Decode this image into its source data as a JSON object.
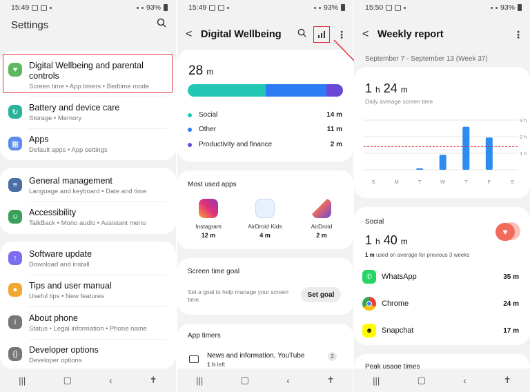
{
  "settings": {
    "time": "15:49",
    "battery": "93%",
    "title": "Settings",
    "items": [
      {
        "title": "Digital Wellbeing and parental controls",
        "sub": "Screen time  •  App timers  •  Bedtime mode",
        "color": "#5cb85c"
      },
      {
        "title": "Battery and device care",
        "sub": "Storage  •  Memory",
        "color": "#2bb39a"
      },
      {
        "title": "Apps",
        "sub": "Default apps  •  App settings",
        "color": "#5b8def"
      },
      {
        "title": "General management",
        "sub": "Language and keyboard  •  Date and time",
        "color": "#4a6fa5"
      },
      {
        "title": "Accessibility",
        "sub": "TalkBack  •  Mono audio  •  Assistant menu",
        "color": "#3aa05a"
      },
      {
        "title": "Software update",
        "sub": "Download and install",
        "color": "#7b6cf0"
      },
      {
        "title": "Tips and user manual",
        "sub": "Useful tips  •  New features",
        "color": "#f0a830"
      },
      {
        "title": "About phone",
        "sub": "Status  •  Legal information  •  Phone name",
        "color": "#777777"
      },
      {
        "title": "Developer options",
        "sub": "Developer options",
        "color": "#777777"
      }
    ]
  },
  "wellbeing": {
    "time": "15:49",
    "battery": "93%",
    "title": "Digital Wellbeing",
    "total_value": "28",
    "total_unit": "m",
    "bar": [
      {
        "fraction": 0.5,
        "color": "#22c7b5"
      },
      {
        "fraction": 0.393,
        "color": "#2d7cf6"
      },
      {
        "fraction": 0.107,
        "color": "#6a48d7"
      }
    ],
    "legend": [
      {
        "name": "Social",
        "value": "14 m",
        "color": "#22c7b5"
      },
      {
        "name": "Other",
        "value": "11 m",
        "color": "#2d7cf6"
      },
      {
        "name": "Productivity and finance",
        "value": "2 m",
        "color": "#6a48d7"
      }
    ],
    "most_used_title": "Most used apps",
    "apps": [
      {
        "name": "Instagram",
        "dur": "12 m"
      },
      {
        "name": "AirDroid Kids",
        "dur": "4 m"
      },
      {
        "name": "AirDroid",
        "dur": "2 m"
      }
    ],
    "goal_title": "Screen time goal",
    "goal_desc": "Set a goal to help manage your screen time.",
    "goal_btn": "Set goal",
    "timers_title": "App timers",
    "timer_item": "News and information, YouTube",
    "timer_left_value": "1 h",
    "timer_left_text": " left",
    "timer_badge": "2"
  },
  "report": {
    "time": "15:50",
    "battery": "93%",
    "title": "Weekly report",
    "range": "September 7 - September 13 (Week 37)",
    "avg_h": "1",
    "avg_m": "24",
    "avg_sub": "Daily average screen time",
    "chart_data": {
      "type": "bar",
      "categories": [
        "S",
        "M",
        "T",
        "W",
        "T",
        "F",
        "S"
      ],
      "values": [
        0,
        0,
        0.05,
        0.9,
        2.6,
        1.95,
        0
      ],
      "y_ticks": [
        "3 h",
        "2 h",
        "1 h"
      ],
      "ylim": [
        0,
        3
      ],
      "average": 1.4,
      "bar_color": "#2d8cf0",
      "avg_color": "#e0303a"
    },
    "social_label": "Social",
    "social_h": "1",
    "social_m": "40",
    "social_note_bold": "1 m",
    "social_note": " used on average for previous 3 weeks",
    "social_apps": [
      {
        "name": "WhatsApp",
        "dur": "35 m"
      },
      {
        "name": "Chrome",
        "dur": "24 m"
      },
      {
        "name": "Snapchat",
        "dur": "17 m"
      }
    ],
    "peak_title": "Peak usage times"
  }
}
